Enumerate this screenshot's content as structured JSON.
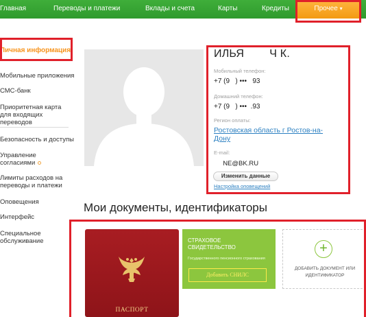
{
  "nav": {
    "items": [
      "Главная",
      "Переводы и платежи",
      "Вклады и счета",
      "Карты",
      "Кредиты",
      "Прочее"
    ],
    "active_caret": "▾"
  },
  "sidebar": {
    "items": [
      "Личная информация",
      "Мобильные приложения",
      "СМС-банк",
      "Приоритетная карта для входящих переводов",
      "Безопасность и доступы",
      "Управление согласиями",
      "Лимиты расходов на переводы и платежи",
      "Оповещения",
      "Интерфейс",
      "Специальное обслуживание"
    ]
  },
  "profile": {
    "name": "ИЛЬЯ        Ч К.",
    "mobile_label": "Мобильный телефон:",
    "mobile_value": "+7 (9   ) •••   93",
    "home_label": "Домашний телефон:",
    "home_value": "+7 (9   ) •••  .93",
    "region_label": "Регион оплаты:",
    "region_value": "Ростовская область г Ростов-на-Дону",
    "email_label": "E-mail:",
    "email_value": "     NE@BK.RU",
    "edit_button": "Изменить данные",
    "notify_link": "Настройка оповещений"
  },
  "documents": {
    "title": "Мои документы, идентификаторы",
    "passport_label": "ПАСПОРТ",
    "snils_title": "СТРАХОВОЕ СВИДЕТЕЛЬСТВО",
    "snils_subtitle": "Государственного пенсионного страхования",
    "snils_button": "Добавить СНИЛС",
    "add_label": "ДОБАВИТЬ ДОКУМЕНТ ИЛИ ИДЕНТИФИКАТОР",
    "add_icon": "plus-icon"
  },
  "colors": {
    "nav_green": "#2f9a2d",
    "nav_active": "#f39a12",
    "highlight": "#e0202a",
    "link": "#2a7fc1",
    "snils_green": "#8cc63e",
    "passport_red": "#a81d22"
  }
}
